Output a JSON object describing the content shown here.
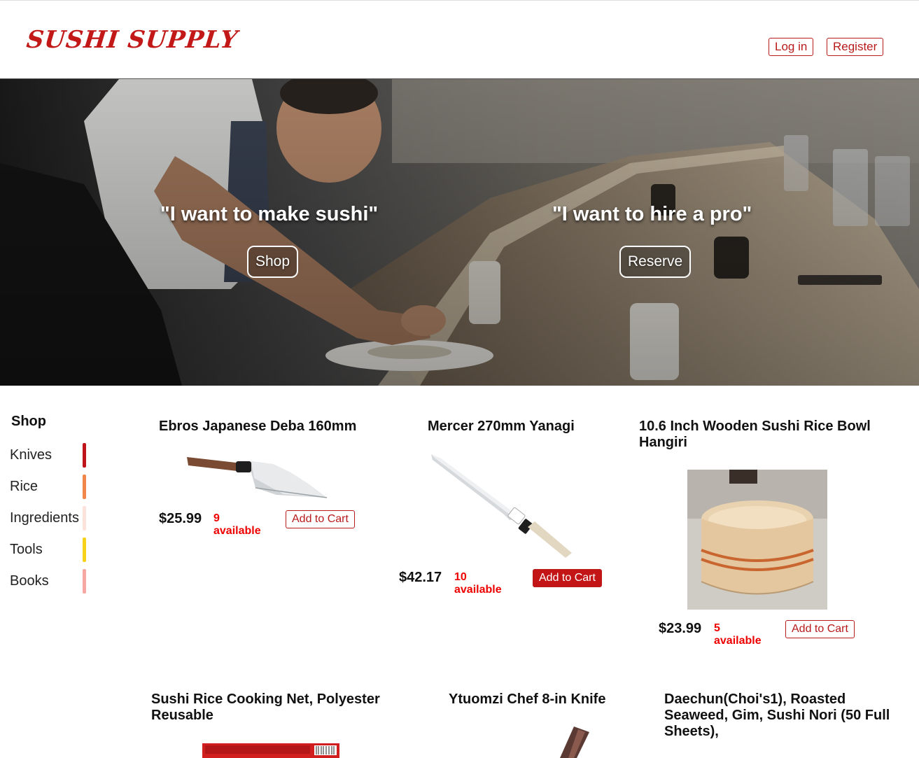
{
  "header": {
    "logo": "Sushi Supply",
    "login_label": "Log in",
    "register_label": "Register"
  },
  "hero": {
    "left_text": "\"I want to make sushi\"",
    "left_button": "Shop",
    "right_text": "\"I want to hire a pro\"",
    "right_button": "Reserve"
  },
  "sidebar": {
    "title": "Shop",
    "items": [
      {
        "label": "Knives",
        "color": "#c0141b"
      },
      {
        "label": "Rice",
        "color": "#f0864a"
      },
      {
        "label": "Ingredients",
        "color": "#fbe3dc"
      },
      {
        "label": "Tools",
        "color": "#f7d21a"
      },
      {
        "label": "Books",
        "color": "#f6a7a2"
      }
    ]
  },
  "products": [
    {
      "title": "Ebros Japanese Deba 160mm",
      "price": "$25.99",
      "available": "9 available",
      "cart_label": "Add to Cart",
      "image": "deba-knife-image"
    },
    {
      "title": "Mercer 270mm Yanagi",
      "price": "$42.17",
      "available": "10 available",
      "cart_label": "Add to Cart",
      "image": "yanagi-knife-image"
    },
    {
      "title": "10.6 Inch Wooden Sushi Rice Bowl Hangiri",
      "price": "$23.99",
      "available": "5 available",
      "cart_label": "Add to Cart",
      "image": "hangiri-bowl-image"
    },
    {
      "title": "Sushi Rice Cooking Net, Polyester Reusable",
      "image": "cooking-net-image"
    },
    {
      "title": "Ytuomzi Chef 8-in Knife",
      "image": "chef-knife-image"
    },
    {
      "title": "Daechun(Choi's1), Roasted Seaweed, Gim, Sushi Nori (50 Full Sheets),",
      "image": "nori-image"
    }
  ],
  "colors": {
    "brand_red": "#c21818",
    "available_red": "#e00000"
  }
}
